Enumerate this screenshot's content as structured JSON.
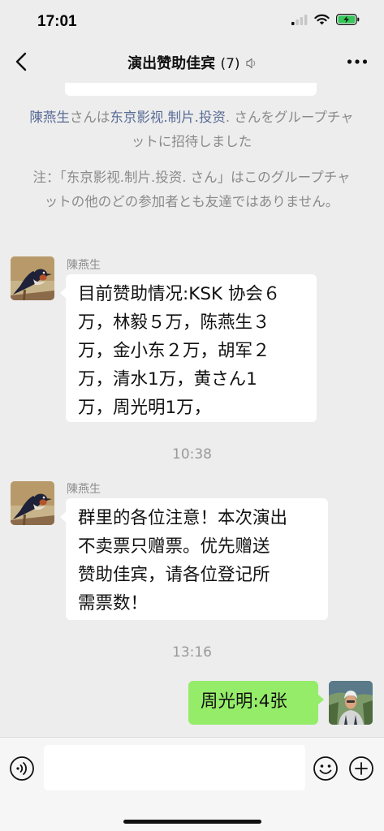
{
  "status_bar": {
    "time": "17:01"
  },
  "nav": {
    "title": "演出赞助佳宾",
    "member_count": "(7)"
  },
  "system_messages": {
    "invite": {
      "inviter": "陳燕生",
      "part1": "さんは",
      "invitee": "东京影视.制片.投资",
      "part2": ". さんをグループチャットに招待しました"
    },
    "notice": "注：「东京影视.制片.投资. さん」はこのグループチャットの他のどの参加者とも友達ではありません。"
  },
  "messages": [
    {
      "sender": "陳燕生",
      "lines": [
        "目前赞助情况:KSK 协会６",
        "万，林毅５万，陈燕生３",
        "万，金小东２万，胡军２",
        "万，清水1万，黄さん1",
        "万，周光明1万，"
      ]
    },
    {
      "time": "10:38"
    },
    {
      "sender": "陳燕生",
      "lines": [
        "群里的各位注意！本次演出",
        "不卖票只赠票。优先赠送",
        "赞助佳宾，请各位登记所",
        "需票数！"
      ]
    },
    {
      "time": "13:16"
    },
    {
      "text": "周光明:4张"
    }
  ]
}
